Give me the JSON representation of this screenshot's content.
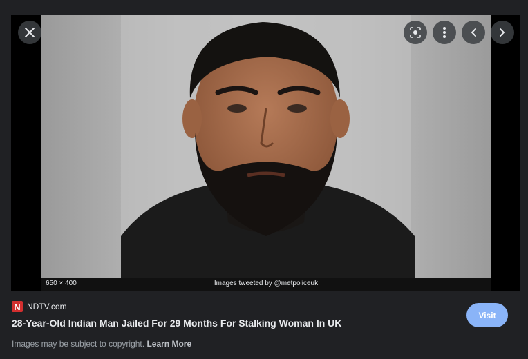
{
  "viewer": {
    "image_dimensions": "650 × 400",
    "image_credit": "Images tweeted by @metpoliceuk",
    "close_label": "Close",
    "lens_label": "Search inside image",
    "more_label": "More options",
    "prev_label": "Previous",
    "next_label": "Next"
  },
  "source": {
    "logo_letter": "N",
    "logo_color": "#d32f2f",
    "site_name": "NDTV.com"
  },
  "result": {
    "title": "28-Year-Old Indian Man Jailed For 29 Months For Stalking Woman In UK",
    "visit_label": "Visit",
    "visit_color": "#8ab4f8",
    "copyright_text": "Images may be subject to copyright.",
    "learn_more_label": "Learn More"
  }
}
